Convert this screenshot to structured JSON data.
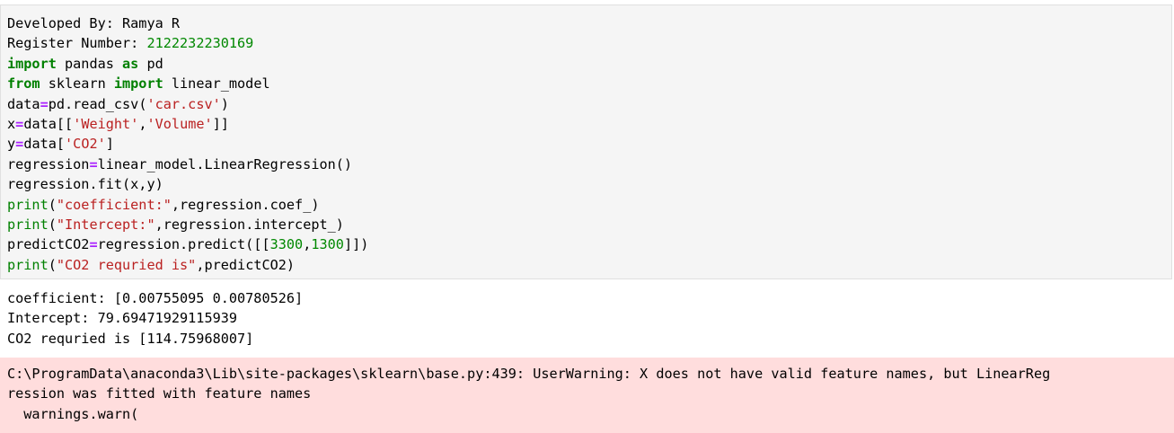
{
  "code_cell": {
    "line1": "Developed By: Ramya R",
    "line2_prefix": "Register Number: ",
    "line2_number": "2122232230169",
    "line3": {
      "kw1": "import",
      "mid": " pandas ",
      "kw2": "as",
      "tail": " pd"
    },
    "line4": {
      "kw1": "from",
      "mid": " sklearn ",
      "kw2": "import",
      "tail": " linear_model"
    },
    "line5": {
      "a": "data",
      "eq": "=",
      "b": "pd.read_csv(",
      "s": "'car.csv'",
      "c": ")"
    },
    "line6": {
      "a": "x",
      "eq": "=",
      "b": "data[[",
      "s1": "'Weight'",
      "comma": ",",
      "s2": "'Volume'",
      "c": "]]"
    },
    "line7": {
      "a": "y",
      "eq": "=",
      "b": "data[",
      "s": "'CO2'",
      "c": "]"
    },
    "line8": {
      "a": "regression",
      "eq": "=",
      "b": "linear_model.LinearRegression()"
    },
    "line9": "regression.fit(x,y)",
    "line10": {
      "fn": "print",
      "p": "(",
      "s": "\"coefficient:\"",
      "c": ",regression.coef_)"
    },
    "line11": {
      "fn": "print",
      "p": "(",
      "s": "\"Intercept:\"",
      "c": ",regression.intercept_)"
    },
    "line12": {
      "a": "predictCO2",
      "eq": "=",
      "b": "regression.predict([[",
      "n1": "3300",
      "comma": ",",
      "n2": "1300",
      "c": "]])"
    },
    "line13": {
      "fn": "print",
      "p": "(",
      "s": "\"CO2 requried is\"",
      "c": ",predictCO2)"
    }
  },
  "output": {
    "line1": "coefficient: [0.00755095 0.00780526]",
    "line2": "Intercept: 79.69471929115939",
    "line3": "CO2 requried is [114.75968007]"
  },
  "stderr": {
    "line1": "C:\\ProgramData\\anaconda3\\Lib\\site-packages\\sklearn\\base.py:439: UserWarning: X does not have valid feature names, but LinearReg",
    "line2": "ression was fitted with feature names",
    "line3": "  warnings.warn("
  },
  "colors": {
    "code_bg": "#f5f5f5",
    "stderr_bg": "#ffdddd",
    "keyword": "#008000",
    "string": "#ba2121",
    "number": "#008800",
    "operator": "#aa22ff"
  }
}
